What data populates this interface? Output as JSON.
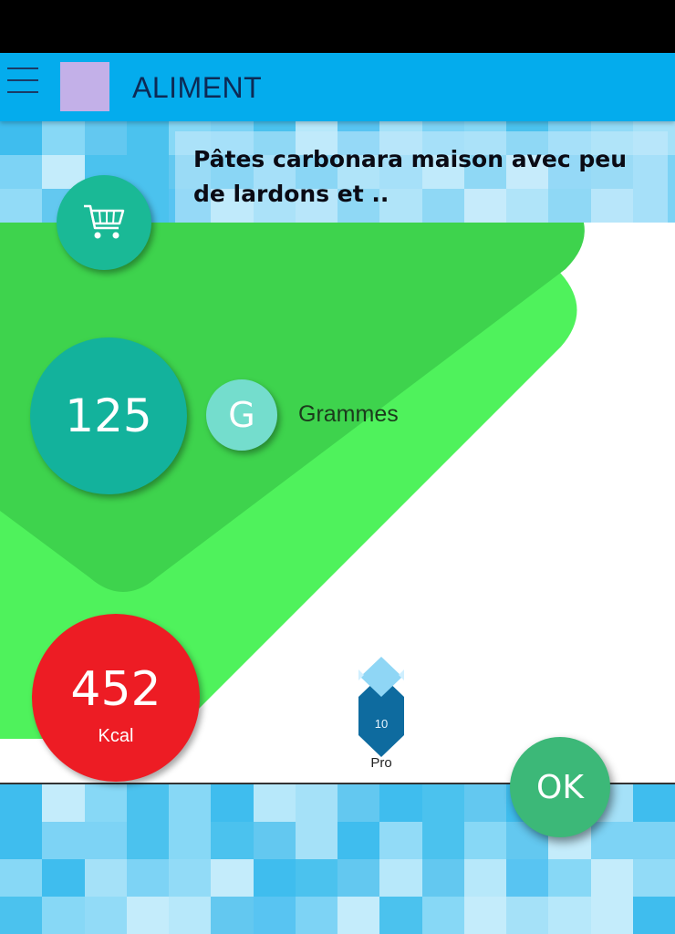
{
  "header": {
    "title": "ALIMENT",
    "menu_icon": "hamburger-menu-icon",
    "logo_color": "#c3b0e8",
    "bar_color": "#04aced"
  },
  "food": {
    "name": "Pâtes carbonara maison avec peu de lardons et .."
  },
  "cart_button": {
    "icon": "shopping-cart-icon"
  },
  "quantity": {
    "value": "125",
    "unit_letter": "G",
    "unit_label": "Grammes"
  },
  "energy": {
    "value": "452",
    "unit": "Kcal"
  },
  "macros": [
    {
      "label": "Pro",
      "value": "10"
    }
  ],
  "actions": {
    "ok_label": "OK"
  },
  "colors": {
    "quantity_circle": "#13b29c",
    "unit_circle": "#74ddcd",
    "kcal_circle": "#ed1c24",
    "ok_button": "#3cb878",
    "green_shape_light": "#4ff25c",
    "green_shape_dark": "#3ed34d"
  }
}
